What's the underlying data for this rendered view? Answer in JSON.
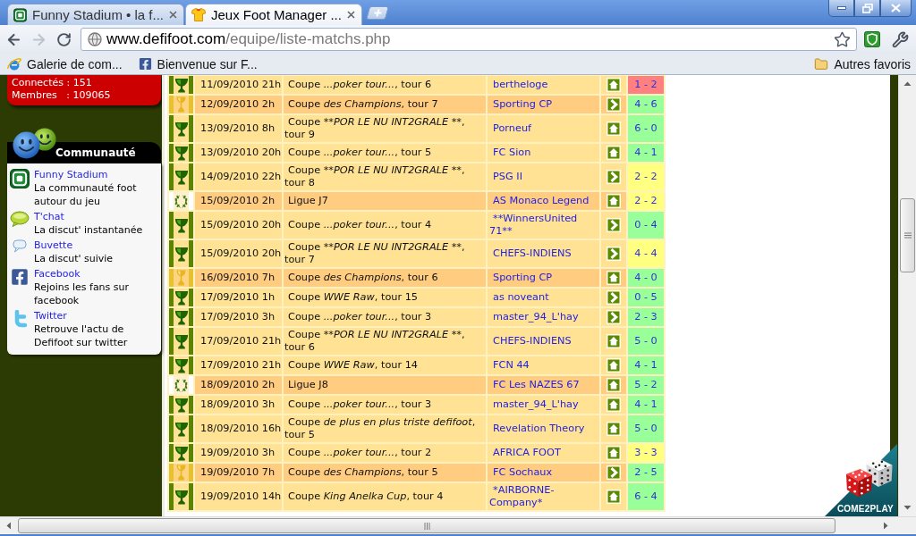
{
  "browser": {
    "tabs": [
      {
        "title": "Funny Stadium • la f...",
        "kind": "fs",
        "selected": false
      },
      {
        "title": "Jeux Foot Manager ...",
        "kind": "shirt",
        "selected": true
      }
    ],
    "nav_buttons": [
      {
        "kind": "back",
        "disabled": false
      },
      {
        "kind": "forward",
        "disabled": true
      },
      {
        "kind": "reload",
        "disabled": false
      }
    ],
    "address": {
      "domain": "www.defifoot.com",
      "path": "/equipe/liste-matchs.php"
    },
    "bookmarks": [
      {
        "kind": "browser",
        "label": "Galerie de com..."
      },
      {
        "kind": "facebook",
        "label": "Bienvenue sur F..."
      }
    ],
    "other_bookmarks": "Autres favoris"
  },
  "stats": [
    "Connectés : 151",
    "Membres   : 109065"
  ],
  "community": {
    "title": "Communauté",
    "items": [
      {
        "kind": "site",
        "link": "Funny Stadium",
        "description": "La communauté foot autour du jeu"
      },
      {
        "kind": "chat",
        "link": "T'chat",
        "description": "La discut' instantanée"
      },
      {
        "kind": "forum",
        "link": "Buvette",
        "description": "La discut' suivie"
      },
      {
        "kind": "facebook",
        "link": "Facebook",
        "description": "Rejoins les fans sur facebook"
      },
      {
        "kind": "twitter",
        "link": "Twitter",
        "description": "Retrouve l'actu de Defifoot sur twitter"
      }
    ]
  },
  "matches": [
    {
      "kind": "cup",
      "date": "11/09/2010 21h",
      "competition": {
        "label": "Coupe ",
        "name": "...poker tour...",
        "round": ", tour 6"
      },
      "opponent": "bertheloge",
      "venue": {
        "kind": "home"
      },
      "score": "1 - 2",
      "color": "#ff8080"
    },
    {
      "kind": "champions",
      "date": "12/09/2010 2h",
      "competition": {
        "label": "Coupe ",
        "name": "des Champions",
        "round": ", tour 7"
      },
      "opponent": "Sporting CP",
      "venue": {
        "kind": "away"
      },
      "score": "4 - 6",
      "color": "#99ff99"
    },
    {
      "kind": "cup",
      "date": "13/09/2010 8h",
      "competition": {
        "label": "Coupe ",
        "name": "**POR LE NU INT2GRALE **",
        "round": ", tour 9"
      },
      "opponent": "Porneuf",
      "venue": {
        "kind": "home"
      },
      "score": "6 - 0",
      "color": "#99ff99"
    },
    {
      "kind": "cup",
      "date": "13/09/2010 20h",
      "competition": {
        "label": "Coupe ",
        "name": "...poker tour...",
        "round": ", tour 5"
      },
      "opponent": "FC Sion",
      "venue": {
        "kind": "home"
      },
      "score": "4 - 1",
      "color": "#99ff99"
    },
    {
      "kind": "cup",
      "date": "14/09/2010 22h",
      "competition": {
        "label": "Coupe ",
        "name": "**POR LE NU INT2GRALE **",
        "round": ", tour 8"
      },
      "opponent": "PSG II",
      "venue": {
        "kind": "away"
      },
      "score": "2 - 2",
      "color": "#ffff80"
    },
    {
      "kind": "league",
      "date": "15/09/2010 2h",
      "competition": {
        "label": "Ligue J7"
      },
      "opponent": "AS Monaco Legend",
      "venue": {
        "kind": "home"
      },
      "score": "2 - 2",
      "color": "#ffff80"
    },
    {
      "kind": "cup",
      "date": "15/09/2010 20h",
      "competition": {
        "label": "Coupe ",
        "name": "...poker tour...",
        "round": ", tour 4"
      },
      "opponent": "**WinnersUnited 71**",
      "venue": {
        "kind": "away"
      },
      "score": "0 - 4",
      "color": "#99ff99"
    },
    {
      "kind": "cup",
      "date": "15/09/2010 20h",
      "competition": {
        "label": "Coupe ",
        "name": "**POR LE NU INT2GRALE **",
        "round": ", tour 7"
      },
      "opponent": "CHEFS-INDIENS",
      "venue": {
        "kind": "away"
      },
      "score": "4 - 4",
      "color": "#ffff80"
    },
    {
      "kind": "champions",
      "date": "16/09/2010 7h",
      "competition": {
        "label": "Coupe ",
        "name": "des Champions",
        "round": ", tour 6"
      },
      "opponent": "Sporting CP",
      "venue": {
        "kind": "home"
      },
      "score": "4 - 0",
      "color": "#99ff99"
    },
    {
      "kind": "cup",
      "date": "17/09/2010 1h",
      "competition": {
        "label": "Coupe ",
        "name": "WWE Raw",
        "round": ", tour 15"
      },
      "opponent": "as noveant",
      "venue": {
        "kind": "away"
      },
      "score": "0 - 5",
      "color": "#99ff99"
    },
    {
      "kind": "cup",
      "date": "17/09/2010 3h",
      "competition": {
        "label": "Coupe ",
        "name": "...poker tour...",
        "round": ", tour 3"
      },
      "opponent": "master_94_L'hay",
      "venue": {
        "kind": "away"
      },
      "score": "2 - 3",
      "color": "#99ff99"
    },
    {
      "kind": "cup",
      "date": "17/09/2010 21h",
      "competition": {
        "label": "Coupe ",
        "name": "**POR LE NU INT2GRALE **",
        "round": ", tour 6"
      },
      "opponent": "CHEFS-INDIENS",
      "venue": {
        "kind": "home"
      },
      "score": "5 - 0",
      "color": "#99ff99"
    },
    {
      "kind": "cup",
      "date": "17/09/2010 21h",
      "competition": {
        "label": "Coupe ",
        "name": "WWE Raw",
        "round": ", tour 14"
      },
      "opponent": "FCN 44",
      "venue": {
        "kind": "home"
      },
      "score": "4 - 1",
      "color": "#99ff99"
    },
    {
      "kind": "league",
      "date": "18/09/2010 2h",
      "competition": {
        "label": "Ligue J8"
      },
      "opponent": "FC Les NAZES 67",
      "venue": {
        "kind": "home"
      },
      "score": "5 - 2",
      "color": "#99ff99"
    },
    {
      "kind": "cup",
      "date": "18/09/2010 3h",
      "competition": {
        "label": "Coupe ",
        "name": "...poker tour...",
        "round": ", tour 3"
      },
      "opponent": "master_94_L'hay",
      "venue": {
        "kind": "home"
      },
      "score": "4 - 1",
      "color": "#99ff99"
    },
    {
      "kind": "cup",
      "date": "18/09/2010 16h",
      "competition": {
        "label": "Coupe ",
        "name": "de plus en plus triste defifoot",
        "round": ", tour 5"
      },
      "opponent": "Revelation Theory",
      "venue": {
        "kind": "home"
      },
      "score": "5 - 0",
      "color": "#99ff99"
    },
    {
      "kind": "cup",
      "date": "19/09/2010 3h",
      "competition": {
        "label": "Coupe ",
        "name": "...poker tour...",
        "round": ", tour 2"
      },
      "opponent": "AFRICA FOOT",
      "venue": {
        "kind": "home"
      },
      "score": "3 - 3",
      "color": "#ffff80"
    },
    {
      "kind": "champions",
      "date": "19/09/2010 7h",
      "competition": {
        "label": "Coupe ",
        "name": "des Champions",
        "round": ", tour 5"
      },
      "opponent": "FC Sochaux",
      "venue": {
        "kind": "away"
      },
      "score": "2 - 5",
      "color": "#99ff99"
    },
    {
      "kind": "cup",
      "date": "19/09/2010 14h",
      "competition": {
        "label": "Coupe ",
        "name": "King Anelka Cup",
        "round": ", tour 4"
      },
      "opponent": "*AIRBORNE-Company*",
      "venue": {
        "kind": "home"
      },
      "score": "6 - 4",
      "color": "#99ff99"
    }
  ],
  "banner": {
    "text": "COME2PLAY"
  }
}
